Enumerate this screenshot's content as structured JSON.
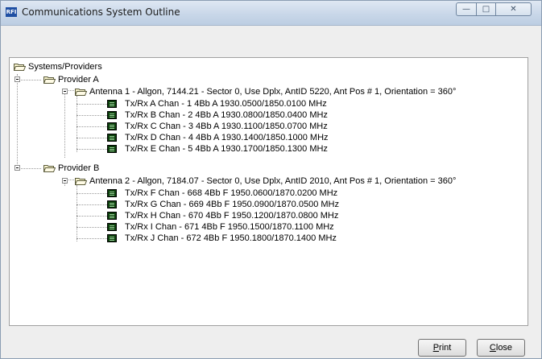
{
  "window": {
    "title": "Communications System Outline",
    "app_icon_text": "RFI",
    "controls": {
      "minimize": "—",
      "maximize": "□",
      "close": "✕"
    }
  },
  "tree": {
    "root": "Systems/Providers",
    "providers": [
      {
        "label": "Provider A",
        "antenna": "Antenna 1 - Allgon, 7144.21 - Sector 0,  Use Dplx,  AntID 5220,  Ant Pos # 1,  Orientation = 360°",
        "channels": [
          "Tx/Rx  A   Chan - 1   4Bb   A   1930.0500/1850.0100 MHz",
          "Tx/Rx  B   Chan - 2   4Bb   A   1930.0800/1850.0400 MHz",
          "Tx/Rx  C   Chan - 3   4Bb   A   1930.1100/1850.0700 MHz",
          "Tx/Rx  D   Chan - 4   4Bb   A   1930.1400/1850.1000 MHz",
          "Tx/Rx  E   Chan - 5   4Bb   A   1930.1700/1850.1300 MHz"
        ]
      },
      {
        "label": "Provider B",
        "antenna": "Antenna 2 - Allgon, 7184.07 - Sector 0,  Use Dplx,  AntID 2010,  Ant Pos # 1,  Orientation = 360°",
        "channels": [
          "Tx/Rx  F   Chan - 668   4Bb   F   1950.0600/1870.0200 MHz",
          "Tx/Rx  G   Chan - 669   4Bb   F   1950.0900/1870.0500 MHz",
          "Tx/Rx  H   Chan - 670   4Bb   F   1950.1200/1870.0800 MHz",
          "Tx/Rx  I    Chan - 671   4Bb   F   1950.1500/1870.1100 MHz",
          "Tx/Rx  J   Chan - 672   4Bb   F   1950.1800/1870.1400 MHz"
        ]
      }
    ]
  },
  "buttons": {
    "print_first": "P",
    "print_rest": "rint",
    "close_first": "C",
    "close_rest": "lose"
  }
}
